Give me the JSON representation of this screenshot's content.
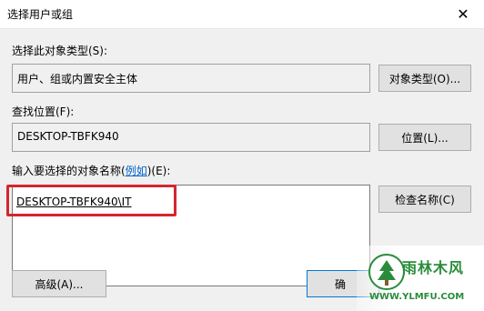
{
  "window": {
    "title": "选择用户或组",
    "close_glyph": "✕"
  },
  "object_type": {
    "label": "选择此对象类型(S):",
    "value": "用户、组或内置安全主体",
    "button_label": "对象类型(O)..."
  },
  "location": {
    "label": "查找位置(F):",
    "value": "DESKTOP-TBFK940",
    "button_label": "位置(L)..."
  },
  "names": {
    "label_prefix": "输入要选择的对象名称(",
    "label_link": "例如",
    "label_suffix": ")(E):",
    "value": "DESKTOP-TBFK940\\IT",
    "check_button_label": "检查名称(C)"
  },
  "footer": {
    "advanced_label": "高级(A)...",
    "ok_label": "确"
  },
  "watermark": {
    "name": "雨林木风",
    "url": "WWW.YLMFU.COM"
  },
  "colors": {
    "highlight": "#d6252e",
    "link": "#0066cc",
    "watermark": "#2a8c3b"
  }
}
